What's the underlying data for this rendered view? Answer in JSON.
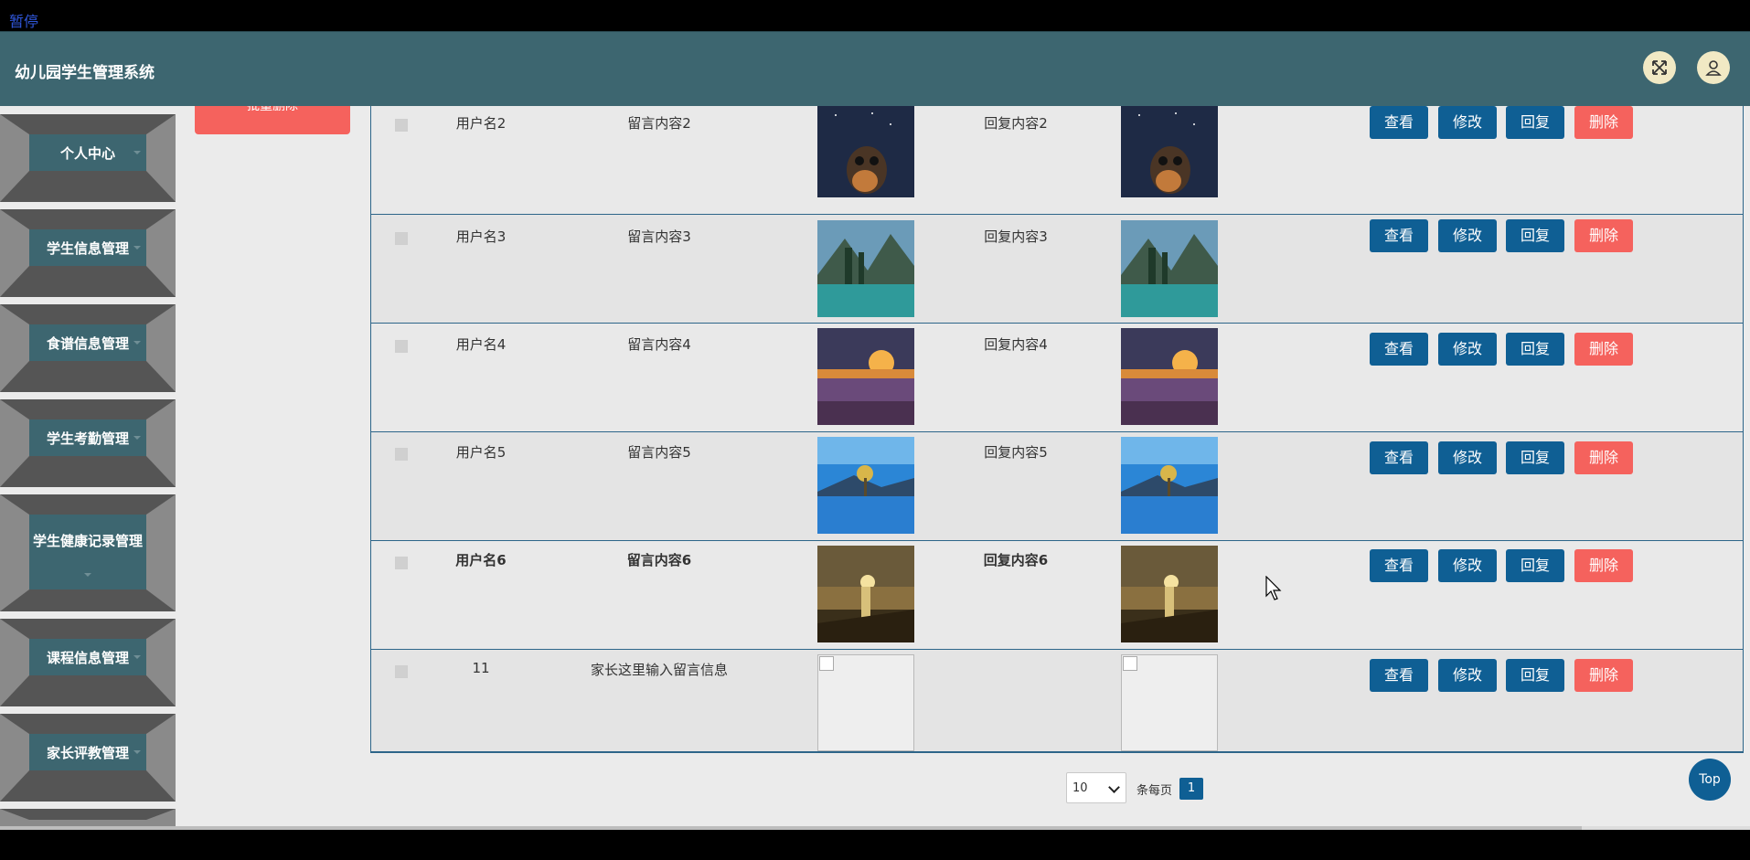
{
  "overlay": {
    "pause_label": "暂停"
  },
  "header": {
    "title": "幼儿园学生管理系统",
    "fullscreen_icon": "fullscreen-icon",
    "user_icon": "user-icon"
  },
  "sidebar": {
    "items": [
      {
        "label": "个人中心"
      },
      {
        "label": "学生信息管理"
      },
      {
        "label": "食谱信息管理"
      },
      {
        "label": "学生考勤管理"
      },
      {
        "label": "学生健康记录管理"
      },
      {
        "label": "课程信息管理"
      },
      {
        "label": "家长评教管理"
      }
    ]
  },
  "toolbar": {
    "batch_delete_label": "批量删除"
  },
  "table": {
    "rows": [
      {
        "user": "用户名2",
        "message": "留言内容2",
        "reply": "回复内容2",
        "image": "night-bear"
      },
      {
        "user": "用户名3",
        "message": "留言内容3",
        "reply": "回复内容3",
        "image": "mountain-lake"
      },
      {
        "user": "用户名4",
        "message": "留言内容4",
        "reply": "回复内容4",
        "image": "lavender-sunset"
      },
      {
        "user": "用户名5",
        "message": "留言内容5",
        "reply": "回复内容5",
        "image": "lake-tree"
      },
      {
        "user": "用户名6",
        "message": "留言内容6",
        "reply": "回复内容6",
        "image": "sea-sunset"
      },
      {
        "user": "11",
        "message": "家长这里输入留言信息",
        "reply": "",
        "image": "broken"
      }
    ],
    "actions": {
      "view": "查看",
      "edit": "修改",
      "reply": "回复",
      "delete": "删除"
    }
  },
  "pager": {
    "page_size": "10",
    "per_page_label": "条每页",
    "current_page": "1"
  },
  "top_button": "Top",
  "colors": {
    "header": "#3d6670",
    "primary": "#0f5f94",
    "danger": "#f5625d"
  }
}
